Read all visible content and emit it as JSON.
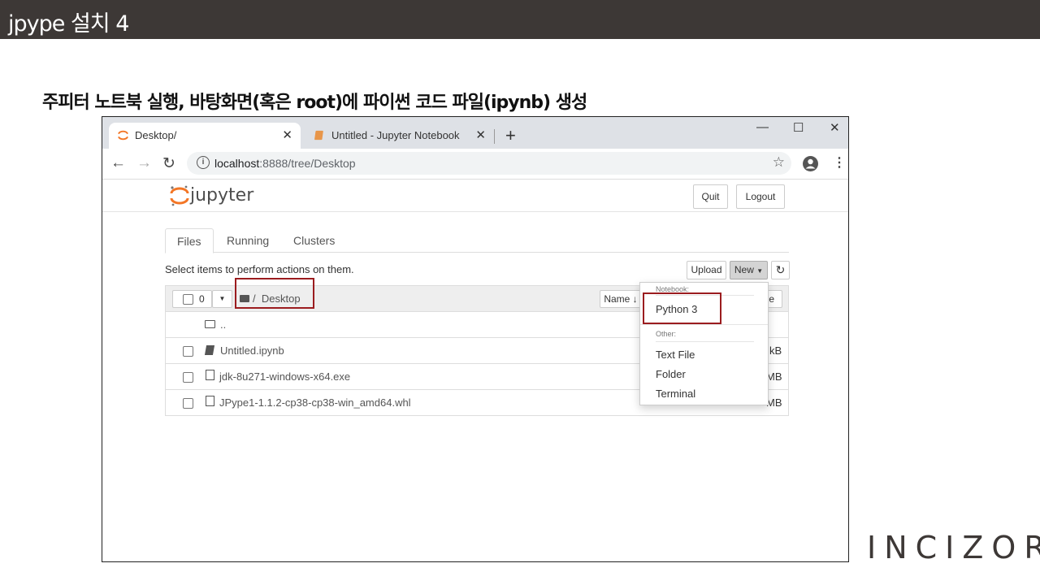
{
  "slide": {
    "title": "jpype 설치 4",
    "subtitle": "주피터 노트북 실행, 바탕화면(혹은 root)에 파이썬 코드 파일(ipynb) 생성",
    "logo_text": "INCIZOR"
  },
  "browser": {
    "tabs": [
      {
        "label": "Desktop/",
        "active": true
      },
      {
        "label": "Untitled - Jupyter Notebook",
        "active": false
      }
    ],
    "url_host": "localhost",
    "url_path": ":8888/tree/Desktop",
    "window_controls": [
      "—",
      "☐",
      "✕"
    ]
  },
  "jupyter": {
    "brand": "jupyter",
    "header_buttons": {
      "quit": "Quit",
      "logout": "Logout"
    },
    "tabs": [
      "Files",
      "Running",
      "Clusters"
    ],
    "select_hint": "Select items to perform actions on them.",
    "upload": "Upload",
    "new": "New",
    "selected_count": "0",
    "breadcrumb_sep": "/",
    "breadcrumb": "Desktop",
    "sort_label": "Name",
    "col_partial": "ze",
    "files": [
      {
        "name": "..",
        "type": "parent",
        "size": ""
      },
      {
        "name": "Untitled.ipynb",
        "type": "notebook",
        "size": "kB"
      },
      {
        "name": "jdk-8u271-windows-x64.exe",
        "type": "file",
        "size": "MB"
      },
      {
        "name": "JPype1-1.1.2-cp38-cp38-win_amd64.whl",
        "type": "file",
        "size": "MB"
      }
    ],
    "new_menu": {
      "notebook_header": "Notebook:",
      "notebook_items": [
        "Python 3"
      ],
      "other_header": "Other:",
      "other_items": [
        "Text File",
        "Folder",
        "Terminal"
      ]
    }
  },
  "colors": {
    "header_bg": "#3d3836",
    "highlight": "#9b1c1f",
    "jupyter_orange": "#f37626",
    "logo_accent": "#e87722"
  }
}
